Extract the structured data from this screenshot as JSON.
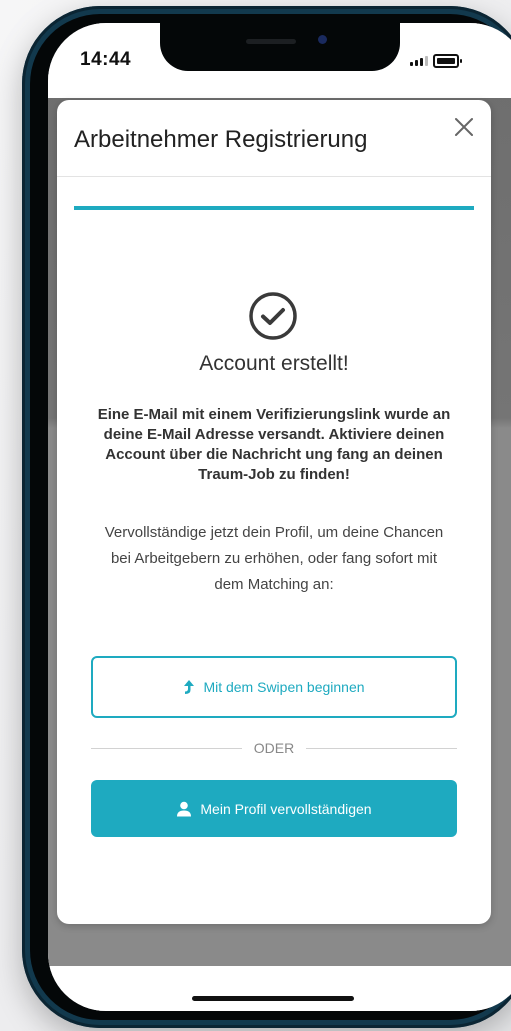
{
  "status_bar": {
    "time": "14:44"
  },
  "modal": {
    "title": "Arbeitnehmer Registrierung",
    "close_icon": "close-icon",
    "progress_percent": 100,
    "success_icon": "check-circle-icon",
    "success_title": "Account erstellt!",
    "info_bold": "Eine E-Mail mit einem Verifizierungslink wurde an deine E-Mail Adresse versandt. Aktiviere deinen Account über die Nachricht ung fang an deinen Traum-Job zu finden!",
    "info_text": "Vervollständige jetzt dein Profil, um deine Chancen bei Arbeitgebern zu erhöhen, oder fang sofort mit dem Matching an:",
    "swipe_button_label": "Mit dem Swipen beginnen",
    "swipe_icon": "arrow-up-icon",
    "or_label": "ODER",
    "profile_button_label": "Mein Profil vervollständigen",
    "profile_icon": "user-icon"
  },
  "colors": {
    "accent": "#1eaac0",
    "text": "#333333",
    "overlay": "#757575"
  }
}
